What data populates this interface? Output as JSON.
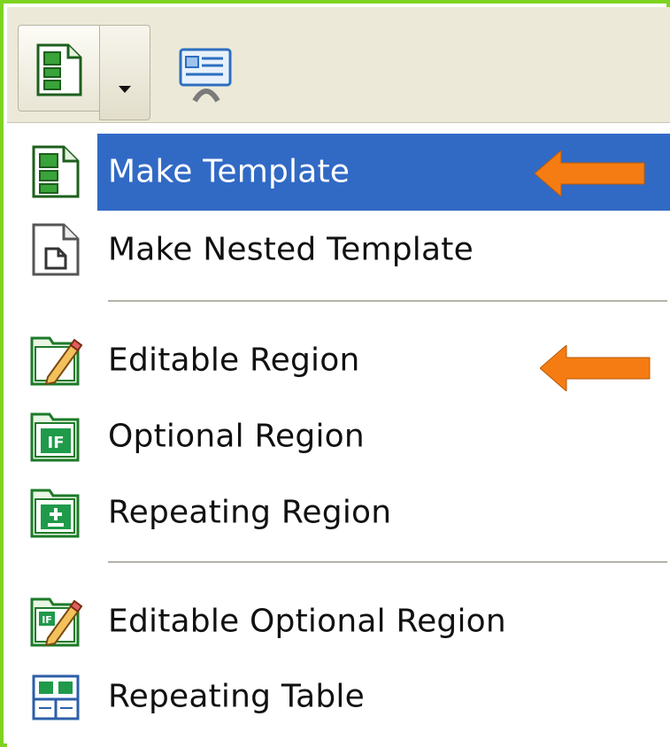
{
  "colors": {
    "frame_border": "#7ed321",
    "selection": "#316ac5",
    "callout_arrow": "#f57c12"
  },
  "toolbar": {
    "template_button_icon": "template-icon",
    "dropdown_icon": "chevron-down-icon",
    "second_button_icon": "template-properties-icon"
  },
  "menu": {
    "items": [
      {
        "label": "Make Template",
        "icon": "template-icon",
        "selected": true
      },
      {
        "label": "Make Nested Template",
        "icon": "nested-template-icon",
        "selected": false
      },
      {
        "label": "Editable Region",
        "icon": "editable-region-icon",
        "selected": false
      },
      {
        "label": "Optional Region",
        "icon": "optional-region-icon",
        "selected": false
      },
      {
        "label": "Repeating Region",
        "icon": "repeating-region-icon",
        "selected": false
      },
      {
        "label": "Editable Optional Region",
        "icon": "editable-optional-region-icon",
        "selected": false
      },
      {
        "label": "Repeating Table",
        "icon": "repeating-table-icon",
        "selected": false
      }
    ]
  },
  "annotations": {
    "callouts": [
      "orange-arrow-make-template",
      "orange-arrow-editable-region"
    ]
  }
}
